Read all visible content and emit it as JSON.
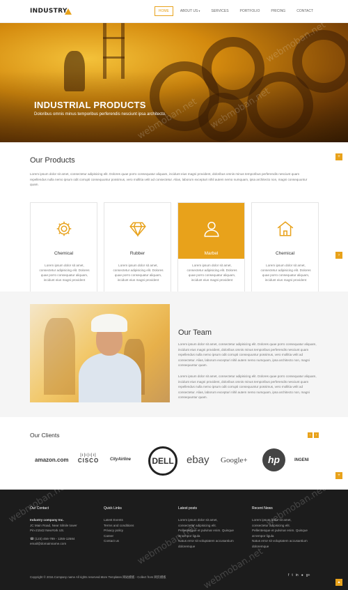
{
  "header": {
    "logo": "INDUSTRY",
    "nav": [
      {
        "label": "HOME",
        "active": true
      },
      {
        "label": "ABOUT US",
        "dropdown": true
      },
      {
        "label": "SERVICES"
      },
      {
        "label": "PORTFOLIO"
      },
      {
        "label": "PRICING"
      },
      {
        "label": "CONTACT"
      }
    ]
  },
  "hero": {
    "title": "INDUSTRIAL PRODUCTS",
    "subtitle": "Doloribus omnis minus temporibus perferendis nesciunt ipsa architecto."
  },
  "products": {
    "title": "Our Products",
    "text": "Lorem ipsum dolor sit amet, consectetur adipisicing elit. Dolores quae porro consequatur aliquam, incidunt eius magni provident, doloribus omnis minus temporibus perferendis nesciunt quam repellendus nulla nemo ipsum odit corrupti consequuntur possimus, vero mollitia velit ad consectetur. Alias, laborum excepturi nihil autem nemo numquam, ipsa architecto non, magni consequuntur quam.",
    "cards": [
      {
        "title": "Chemical",
        "icon": "gear-icon",
        "text": "Lorem ipsum dolor sit amet, consectetur adipisicing elit. Dolores quae porro consequatur aliquam, incidunt eius magni provident",
        "more": "Learn More",
        "active": false
      },
      {
        "title": "Rubber",
        "icon": "diamond-icon",
        "text": "Lorem ipsum dolor sit amet, consectetur adipisicing elit. Dolores quae porro consequatur aliquam, incidunt eius magni provident",
        "more": "Learn More",
        "active": false
      },
      {
        "title": "Marbel",
        "icon": "user-icon",
        "text": "Lorem ipsum dolor sit amet, consectetur adipisicing elit. Dolores quae porro consequatur aliquam, incidunt eius magni provident",
        "more": "Learn More",
        "active": true
      },
      {
        "title": "Chemical",
        "icon": "home-icon",
        "text": "Lorem ipsum dolor sit amet, consectetur adipisicing elit. Dolores quae porro consequatur aliquam, incidunt eius magni provident",
        "more": "Learn More",
        "active": false
      }
    ]
  },
  "team": {
    "title": "Our Team",
    "para1": "Lorem ipsum dolor sit amet, consectetur adipisicing elit. Dolores quae porro consequatur aliquam, incidunt eius magni provident, doloribus omnis minus temporibus perferendis nesciunt quam repellendus nulla nemo ipsum odit corrupti consequuntur possimus, vero mollitia velit ad consectetur. Alias, laborum excepturi nihil autem nemo numquam, ipsa architecto non, magni consequuntur quam.",
    "para2": "Lorem ipsum dolor sit amet, consectetur adipisicing elit. Dolores quae porro consequatur aliquam, incidunt eius magni provident, doloribus omnis minus temporibus perferendis nesciunt quam repellendus nulla nemo ipsum odit corrupti consequuntur possimus, vero mollitia velit ad consectetur. Alias, laborum excepturi nihil autem nemo numquam, ipsa architecto non, magni consequuntur quam."
  },
  "clients": {
    "title": "Our Clients",
    "prev": "‹",
    "next": "›",
    "logos": [
      "amazon.com",
      "CISCO",
      "CityAirline",
      "DELL",
      "ebay",
      "Google+",
      "hp",
      "INGENI"
    ]
  },
  "footer": {
    "contact": {
      "title": "Our Contact",
      "company": "Industry company Inc.",
      "lines": [
        "JC Main Road, Near Silnile tower",
        "Pin-21542 NewYork US.",
        "(123) 456-789 - 1255-12584",
        "email@domainname.com"
      ]
    },
    "links": {
      "title": "Quick Links",
      "items": [
        "Latest Events",
        "Terms and conditions",
        "Privacy policy",
        "Career",
        "Contact us"
      ]
    },
    "latest": {
      "title": "Latest posts",
      "lines": [
        "Lorem ipsum dolor sit amet,",
        "consectetur adipisicing elit.",
        "Pellentesque et pulvinar enim. Quisque",
        "at tempor ligula",
        "Natus error sit voluptatem accusantium",
        "doloremque"
      ]
    },
    "recent": {
      "title": "Recent News",
      "lines": [
        "Lorem ipsum dolor sit amet,",
        "consectetur adipisicing elit.",
        "Pellentesque et pulvinar enim. Quisque",
        "at tempor ligula",
        "Natus error sit voluptatem accusantium",
        "doloremque"
      ]
    },
    "copyright": "Copyright © 2016.Company name All rights reserved.More Templates 网站模板 - Collect from 网页模板",
    "social": [
      "f",
      "t",
      "in",
      "●",
      "g+"
    ]
  },
  "watermark": "webmoban.net",
  "colors": {
    "accent": "#e8a21b",
    "footer": "#1c1c1c"
  }
}
